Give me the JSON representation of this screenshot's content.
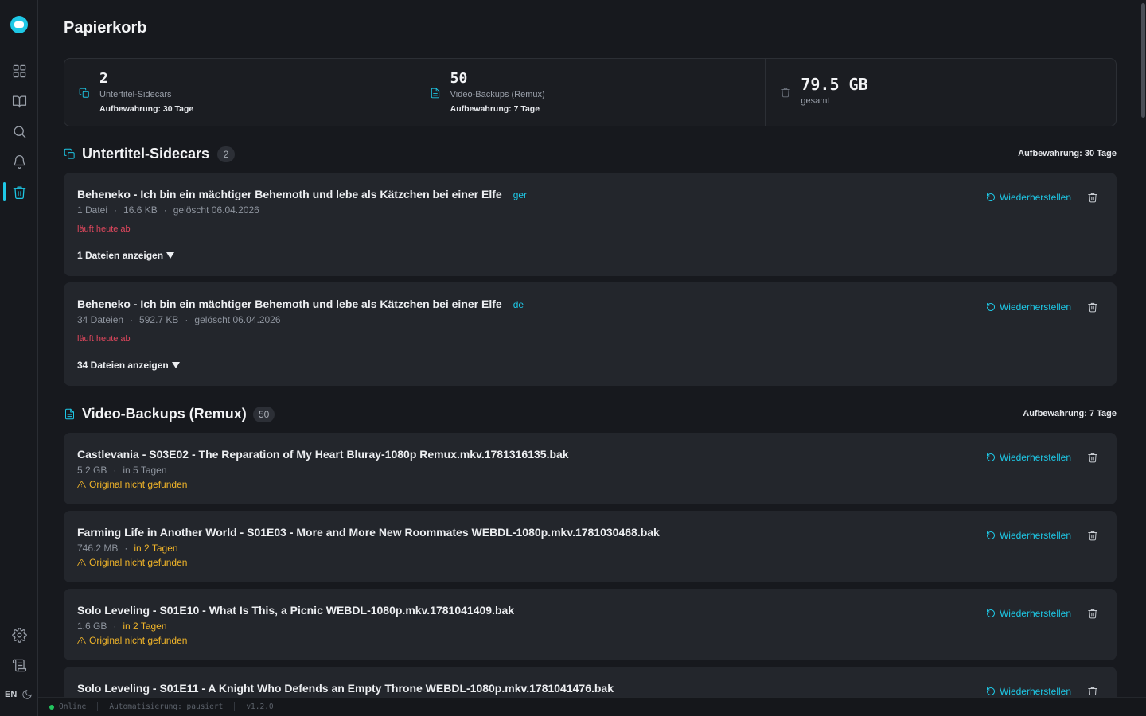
{
  "app": {
    "title": "Papierkorb",
    "accent_color": "#1ec8e6",
    "language": "EN"
  },
  "sidebar": {
    "items": [
      {
        "name": "dashboard",
        "icon": "grid-icon"
      },
      {
        "name": "library",
        "icon": "book-icon"
      },
      {
        "name": "search",
        "icon": "search-icon"
      },
      {
        "name": "notifications",
        "icon": "bell-icon"
      },
      {
        "name": "trash",
        "icon": "trash-icon",
        "active": true
      }
    ],
    "bottom_items": [
      {
        "name": "settings",
        "icon": "gear-icon"
      },
      {
        "name": "logs",
        "icon": "scroll-icon"
      }
    ]
  },
  "stats": [
    {
      "value": "2",
      "label": "Untertitel-Sidecars",
      "retention": "Aufbewahrung: 30 Tage",
      "icon": "copy-icon"
    },
    {
      "value": "50",
      "label": "Video-Backups (Remux)",
      "retention": "Aufbewahrung: 7 Tage",
      "icon": "file-icon"
    },
    {
      "value": "79.5 GB",
      "label": "gesamt",
      "icon": "trash-icon"
    }
  ],
  "sections": {
    "subtitles": {
      "title": "Untertitel-Sidecars",
      "count": "2",
      "retention": "Aufbewahrung: 30 Tage",
      "items": [
        {
          "title": "Beheneko - Ich bin ein mächtiger Behemoth und lebe als Kätzchen bei einer Elfe",
          "lang": "ger",
          "files": "1 Datei",
          "size": "16.6 KB",
          "deleted": "gelöscht 06.04.2026",
          "expire": "läuft heute ab",
          "toggle": "1 Dateien anzeigen",
          "restore": "Wiederherstellen"
        },
        {
          "title": "Beheneko - Ich bin ein mächtiger Behemoth und lebe als Kätzchen bei einer Elfe",
          "lang": "de",
          "files": "34 Dateien",
          "size": "592.7 KB",
          "deleted": "gelöscht 06.04.2026",
          "expire": "läuft heute ab",
          "toggle": "34 Dateien anzeigen",
          "restore": "Wiederherstellen"
        }
      ]
    },
    "videos": {
      "title": "Video-Backups (Remux)",
      "count": "50",
      "retention": "Aufbewahrung: 7 Tage",
      "items": [
        {
          "title": "Castlevania - S03E02 - The Reparation of My Heart Bluray-1080p Remux.mkv.1781316135.bak",
          "size": "5.2 GB",
          "expires": "in 5 Tagen",
          "expires_warn": false,
          "warning": "Original nicht gefunden",
          "restore": "Wiederherstellen"
        },
        {
          "title": "Farming Life in Another World - S01E03 - More and More New Roommates WEBDL-1080p.mkv.1781030468.bak",
          "size": "746.2 MB",
          "expires": "in 2 Tagen",
          "expires_warn": true,
          "warning": "Original nicht gefunden",
          "restore": "Wiederherstellen"
        },
        {
          "title": "Solo Leveling - S01E10 - What Is This, a Picnic WEBDL-1080p.mkv.1781041409.bak",
          "size": "1.6 GB",
          "expires": "in 2 Tagen",
          "expires_warn": true,
          "warning": "Original nicht gefunden",
          "restore": "Wiederherstellen"
        },
        {
          "title": "Solo Leveling - S01E11 - A Knight Who Defends an Empty Throne WEBDL-1080p.mkv.1781041476.bak",
          "restore": "Wiederherstellen"
        }
      ]
    }
  },
  "statusbar": {
    "online": "Online",
    "automation": "Automatisierung: pausiert",
    "version": "v1.2.0"
  }
}
